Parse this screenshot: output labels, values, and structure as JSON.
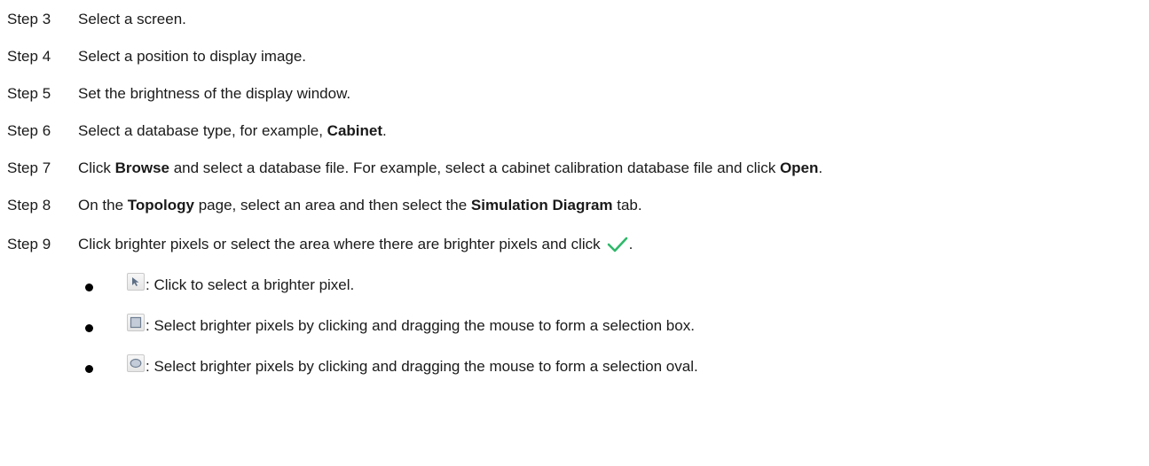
{
  "steps": [
    {
      "label": "Step 3",
      "parts": [
        {
          "t": "Select a screen.",
          "b": false
        }
      ]
    },
    {
      "label": "Step 4",
      "parts": [
        {
          "t": "Select a position to display image.",
          "b": false
        }
      ]
    },
    {
      "label": "Step 5",
      "parts": [
        {
          "t": "Set the brightness of the display window.",
          "b": false
        }
      ]
    },
    {
      "label": "Step 6",
      "parts": [
        {
          "t": "Select a database type, for example, ",
          "b": false
        },
        {
          "t": "Cabinet",
          "b": true
        },
        {
          "t": ".",
          "b": false
        }
      ]
    },
    {
      "label": "Step 7",
      "parts": [
        {
          "t": "Click ",
          "b": false
        },
        {
          "t": "Browse",
          "b": true
        },
        {
          "t": " and select a database file. For example, select a cabinet calibration database file and click ",
          "b": false
        },
        {
          "t": "Open",
          "b": true
        },
        {
          "t": ".",
          "b": false
        }
      ]
    },
    {
      "label": "Step 8",
      "parts": [
        {
          "t": "On the ",
          "b": false
        },
        {
          "t": "Topology",
          "b": true
        },
        {
          "t": " page, select an area and then select the ",
          "b": false
        },
        {
          "t": "Simulation Diagram",
          "b": true
        },
        {
          "t": " tab.",
          "b": false
        }
      ]
    },
    {
      "label": "Step 9",
      "parts": [
        {
          "t": "Click brighter pixels or select the area where there are brighter pixels and click",
          "b": false
        }
      ],
      "trailing_icon": "checkmark-icon",
      "trailing_text": "."
    }
  ],
  "tools": [
    {
      "icon": "pointer-arrow-icon",
      "text": ": Click to select a brighter pixel."
    },
    {
      "icon": "box-select-icon",
      "text": ": Select brighter pixels by clicking and dragging the mouse to form a selection box."
    },
    {
      "icon": "oval-select-icon",
      "text": ": Select brighter pixels by clicking and dragging the mouse to form a selection oval."
    }
  ],
  "colors": {
    "text": "#1a1a1a",
    "checkmark": "#2fb86a",
    "icon_gray": "#7a8aa0"
  }
}
